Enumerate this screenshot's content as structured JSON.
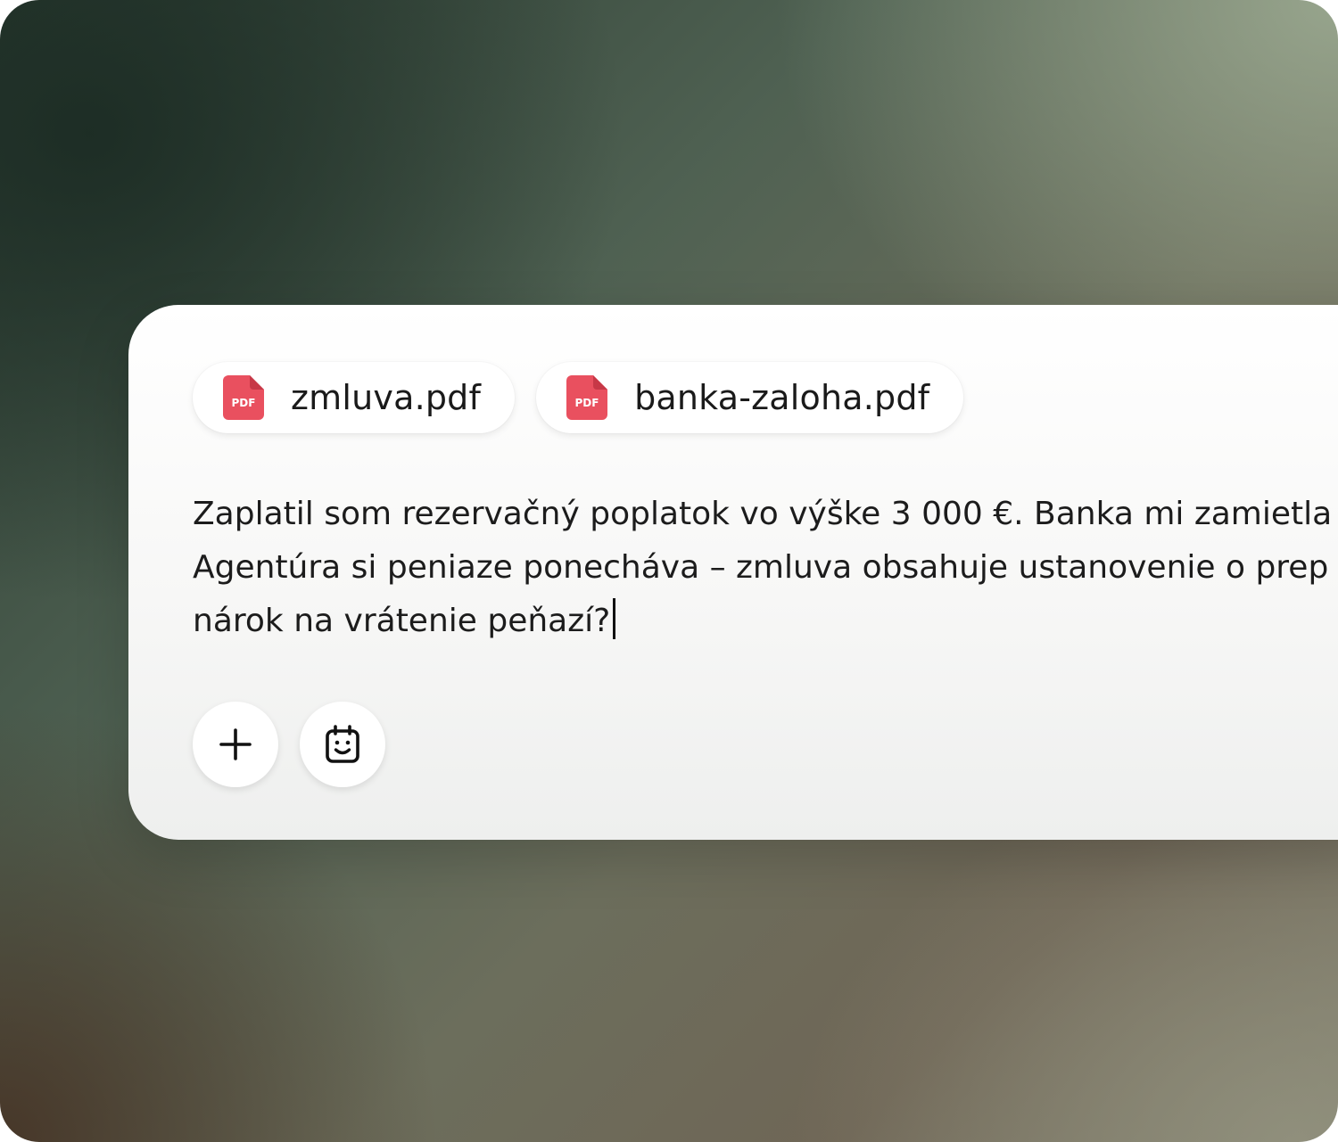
{
  "attachments": [
    {
      "name": "zmluva.pdf",
      "icon": "pdf-file-icon",
      "icon_label": "PDF"
    },
    {
      "name": "banka-zaloha.pdf",
      "icon": "pdf-file-icon",
      "icon_label": "PDF"
    }
  ],
  "message": {
    "lines": [
      "Zaplatil som rezervačný poplatok vo výške 3 000 €. Banka mi zamietla",
      "Agentúra si peniaze ponecháva – zmluva obsahuje ustanovenie o prep",
      "nárok na vrátenie peňazí?"
    ]
  },
  "actions": [
    {
      "name": "add-button",
      "icon": "plus-icon"
    },
    {
      "name": "assistant-button",
      "icon": "calendar-smile-icon"
    }
  ],
  "colors": {
    "pdf_icon": "#e9505f",
    "pdf_fold": "#c73847",
    "text": "#1c1c1c",
    "panel": "#ffffff"
  }
}
